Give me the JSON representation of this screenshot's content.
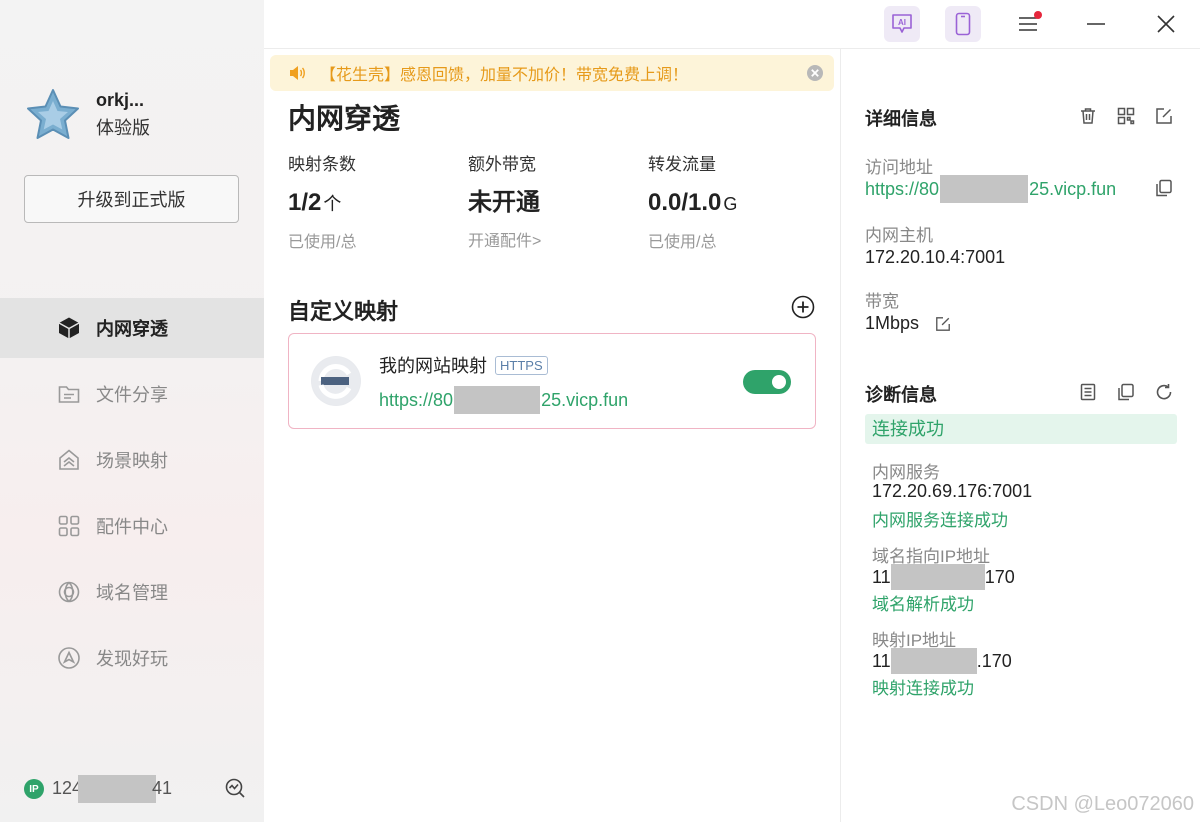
{
  "sidebar": {
    "user_name": "orkj...",
    "user_tier": "体验版",
    "upgrade_label": "升级到正式版",
    "nav": [
      {
        "label": "内网穿透",
        "icon": "cube-icon",
        "active": true
      },
      {
        "label": "文件分享",
        "icon": "folder-icon",
        "active": false
      },
      {
        "label": "场景映射",
        "icon": "home-layers-icon",
        "active": false
      },
      {
        "label": "配件中心",
        "icon": "grid-icon",
        "active": false
      },
      {
        "label": "域名管理",
        "icon": "globe-icon",
        "active": false
      },
      {
        "label": "发现好玩",
        "icon": "compass-icon",
        "active": false
      }
    ],
    "ip_badge": "IP",
    "ip_prefix": "124",
    "ip_suffix": "41"
  },
  "topbar": {
    "ai_label": "AI"
  },
  "notice": {
    "text": "【花生壳】感恩回馈，加量不加价！带宽免费上调！"
  },
  "main": {
    "title": "内网穿透",
    "stats": [
      {
        "label": "映射条数",
        "value": "1/2",
        "unit": "个",
        "sub": "已使用/总"
      },
      {
        "label": "额外带宽",
        "value": "未开通",
        "unit": "",
        "sub": "开通配件>"
      },
      {
        "label": "转发流量",
        "value": "0.0/1.0",
        "unit": "G",
        "sub": "已使用/总"
      }
    ],
    "section_title": "自定义映射",
    "mapping": {
      "name": "我的网站映射",
      "protocol": "HTTPS",
      "url_prefix": "https://80",
      "url_suffix": "25.vicp.fun",
      "enabled": true
    }
  },
  "detail": {
    "title": "详细信息",
    "access_label": "访问地址",
    "access_prefix": "https://80",
    "access_suffix": "25.vicp.fun",
    "host_label": "内网主机",
    "host_value": "172.20.10.4:7001",
    "bandwidth_label": "带宽",
    "bandwidth_value": "1Mbps"
  },
  "diagnosis": {
    "title": "诊断信息",
    "status": "连接成功",
    "service_label": "内网服务",
    "service_value": "172.20.69.176:7001",
    "service_ok": "内网服务连接成功",
    "domain_label": "域名指向IP地址",
    "domain_prefix": "11",
    "domain_suffix": "170",
    "domain_ok": "域名解析成功",
    "mapip_label": "映射IP地址",
    "mapip_prefix": "11",
    "mapip_suffix": ".170",
    "mapip_ok": "映射连接成功"
  },
  "watermark": "CSDN @Leo072060",
  "colors": {
    "accent_green": "#2fa36a",
    "notice_text": "#e69a1a",
    "notice_bg": "#fdf4d9",
    "card_border": "#f0b4c4",
    "red_dot": "#e6263c"
  }
}
